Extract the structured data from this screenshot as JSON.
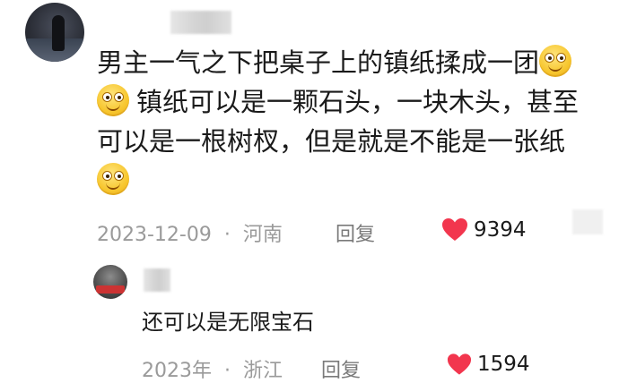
{
  "comment": {
    "avatar_icon": "user-avatar-icon",
    "lines": [
      "男主一气之下把桌子上的镇纸揉成一团",
      "镇纸可以是一颗石头，一块木头，甚至",
      "可以是一根树杈，但是就是不能是一张纸"
    ],
    "date": "2023-12-09",
    "separator": "·",
    "location": "河南",
    "reply_label": "回复",
    "likes": "9394"
  },
  "reply": {
    "text": "还可以是无限宝石",
    "date": "2023年",
    "separator": "·",
    "location": "浙江",
    "reply_label": "回复",
    "likes": "1594"
  },
  "colors": {
    "heart": "#f2364e",
    "meta_text": "#9a9a9a",
    "body_text": "#1a1a1a"
  }
}
